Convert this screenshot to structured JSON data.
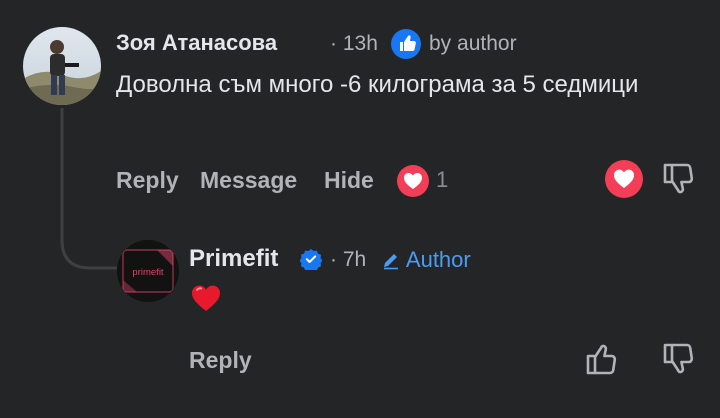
{
  "comment": {
    "author": "Зоя Атанасова",
    "dot": "·",
    "time": "13h",
    "liked_by": "by author",
    "text": "Доволна съм много -6 килограма за 5 седмици",
    "actions": {
      "reply": "Reply",
      "message": "Message",
      "hide": "Hide"
    },
    "reaction_count": "1",
    "reaction_icon": "heart-icon",
    "colors": {
      "love": "#f33e58",
      "like_badge": "#1877f2"
    }
  },
  "reply": {
    "author": "Primefit",
    "avatar_text": "primefit",
    "dot": "·",
    "time": "7h",
    "author_tag": "Author",
    "emoji": "red-heart",
    "actions": {
      "reply": "Reply"
    },
    "colors": {
      "author_tag": "#4b9bf5",
      "verified": "#1877f2"
    }
  }
}
